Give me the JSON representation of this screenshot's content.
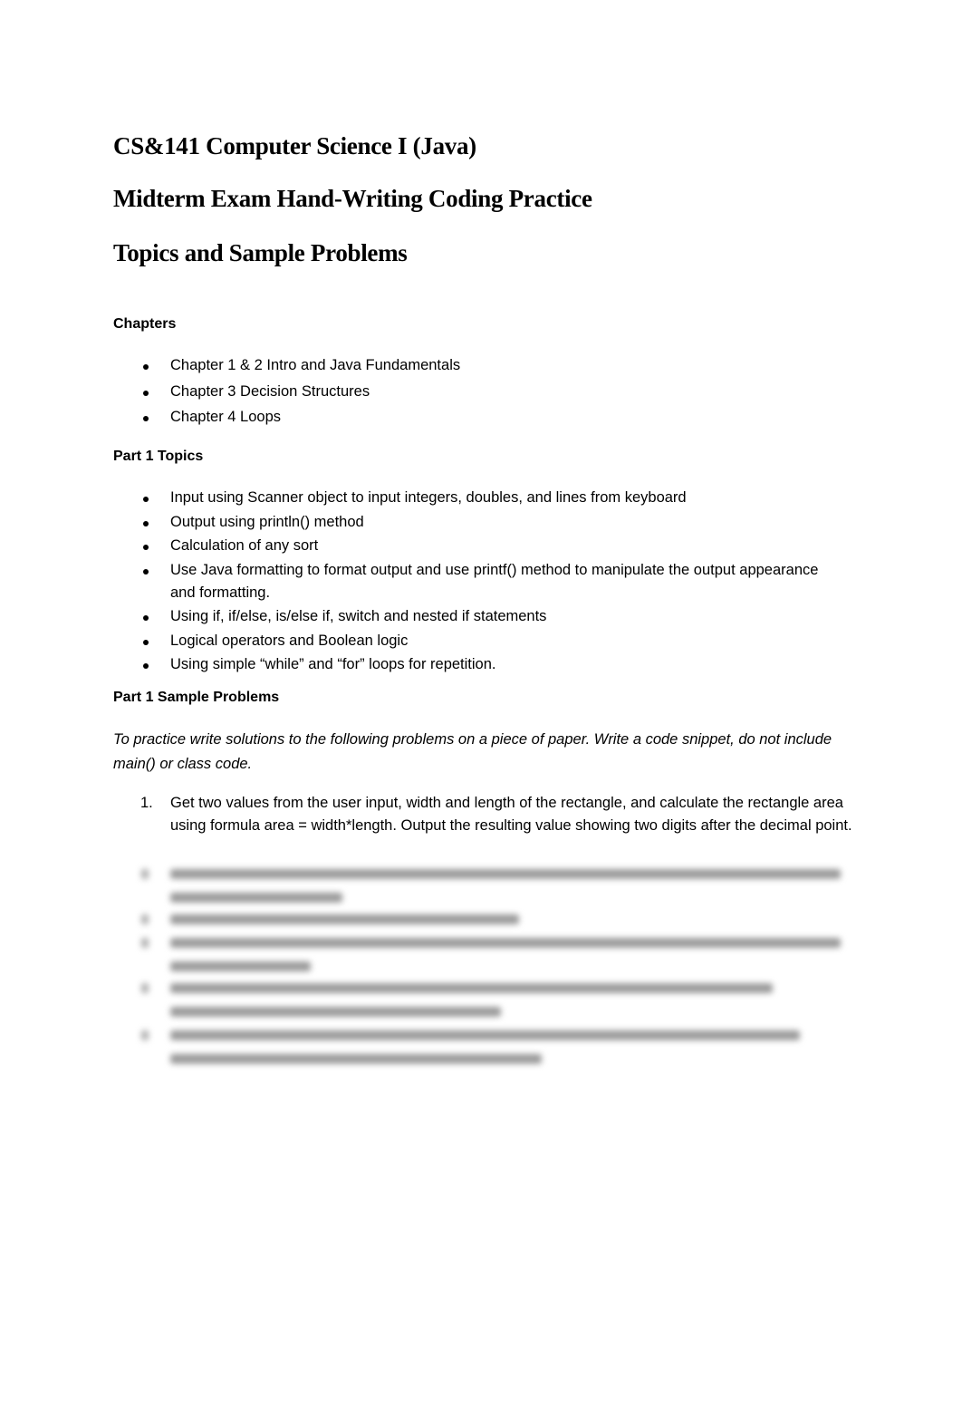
{
  "document": {
    "title_lines": [
      "CS&141 Computer Science I (Java)",
      "Midterm Exam Hand-Writing Coding Practice",
      "Topics and Sample Problems"
    ],
    "chapters": {
      "heading": "Chapters",
      "items": [
        "Chapter 1 & 2 Intro and Java Fundamentals",
        "Chapter 3 Decision Structures",
        "Chapter 4 Loops"
      ]
    },
    "part1_topics": {
      "heading": "Part 1 Topics",
      "items": [
        "Input using Scanner object to input integers, doubles, and lines from keyboard",
        "Output using println() method",
        "Calculation of any sort",
        "Use Java formatting to format output and use printf() method to manipulate the output appearance and formatting.",
        "Using if, if/else, is/else if, switch and nested if statements",
        "Logical operators and Boolean logic",
        "Using simple “while” and “for” loops for repetition."
      ]
    },
    "part1_problems": {
      "heading": "Part 1 Sample Problems",
      "intro": "To practice write solutions to the following problems on a piece of paper. Write a code snippet, do not include main() or class code.",
      "problems": [
        {
          "number": "1.",
          "text": "Get two values from the user input, width and length of the rectangle, and calculate the rectangle area using formula area = width*length. Output the resulting value showing two digits after the decimal point."
        }
      ],
      "remaining_problems_obscured": true
    }
  }
}
